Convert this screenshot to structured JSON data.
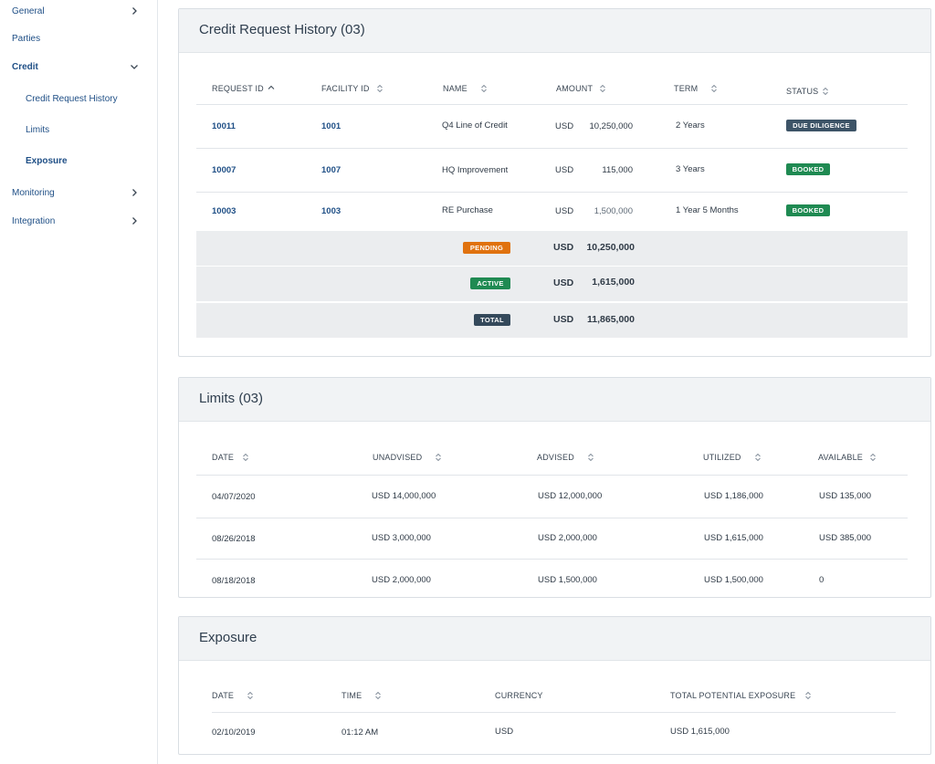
{
  "sidebar": {
    "items": [
      {
        "label": "General"
      },
      {
        "label": "Parties"
      },
      {
        "label": "Credit"
      },
      {
        "label": "Credit Request History"
      },
      {
        "label": "Limits"
      },
      {
        "label": "Exposure"
      },
      {
        "label": "Monitoring"
      },
      {
        "label": "Integration"
      }
    ]
  },
  "credit": {
    "title": "Credit Request History (03)",
    "headers": [
      "REQUEST ID",
      "FACILITY ID",
      "NAME",
      "AMOUNT",
      "TERM",
      "STATUS"
    ],
    "rows": [
      {
        "request_id": "10011",
        "facility_id": "1001",
        "name": "Q4 Line of Credit",
        "currency": "USD",
        "amount": "10,250,000",
        "term": "2 Years",
        "status": "DUE DILIGENCE"
      },
      {
        "request_id": "10007",
        "facility_id": "1007",
        "name": "HQ Improvement",
        "currency": "USD",
        "amount": "115,000",
        "term": "3 Years",
        "status": "BOOKED"
      },
      {
        "request_id": "10003",
        "facility_id": "1003",
        "name": "RE Purchase",
        "currency": "USD",
        "amount": "1,500,000",
        "term": "1 Year 5 Months",
        "status": "BOOKED"
      }
    ],
    "summary": [
      {
        "badge": "PENDING",
        "currency": "USD",
        "amount": "10,250,000"
      },
      {
        "badge": "ACTIVE",
        "currency": "USD",
        "amount": "1,615,000"
      },
      {
        "badge": "TOTAL",
        "currency": "USD",
        "amount": "11,865,000"
      }
    ]
  },
  "limits": {
    "title": "Limits (03)",
    "headers": [
      "DATE",
      "UNADVISED",
      "ADVISED",
      "UTILIZED",
      "AVAILABLE"
    ],
    "rows": [
      {
        "date": "04/07/2020",
        "unadvised": "USD 14,000,000",
        "advised": "USD 12,000,000",
        "utilized": "USD 1,186,000",
        "available": "USD 135,000"
      },
      {
        "date": "08/26/2018",
        "unadvised": "USD 3,000,000",
        "advised": "USD 2,000,000",
        "utilized": "USD 1,615,000",
        "available": "USD 385,000"
      },
      {
        "date": "08/18/2018",
        "unadvised": "USD 2,000,000",
        "advised": "USD 1,500,000",
        "utilized": "USD 1,500,000",
        "available": "0"
      }
    ]
  },
  "exposure": {
    "title": "Exposure",
    "headers": [
      "DATE",
      "TIME",
      "CURRENCY",
      "TOTAL POTENTIAL EXPOSURE"
    ],
    "rows": [
      {
        "date": "02/10/2019",
        "time": "01:12 AM",
        "currency": "USD",
        "total": "USD 1,615,000"
      }
    ]
  },
  "colors": {
    "link": "#1f4f86",
    "due_diligence": "#3d5467",
    "booked": "#1f8a52",
    "pending": "#e0720f",
    "total": "#34495b"
  }
}
